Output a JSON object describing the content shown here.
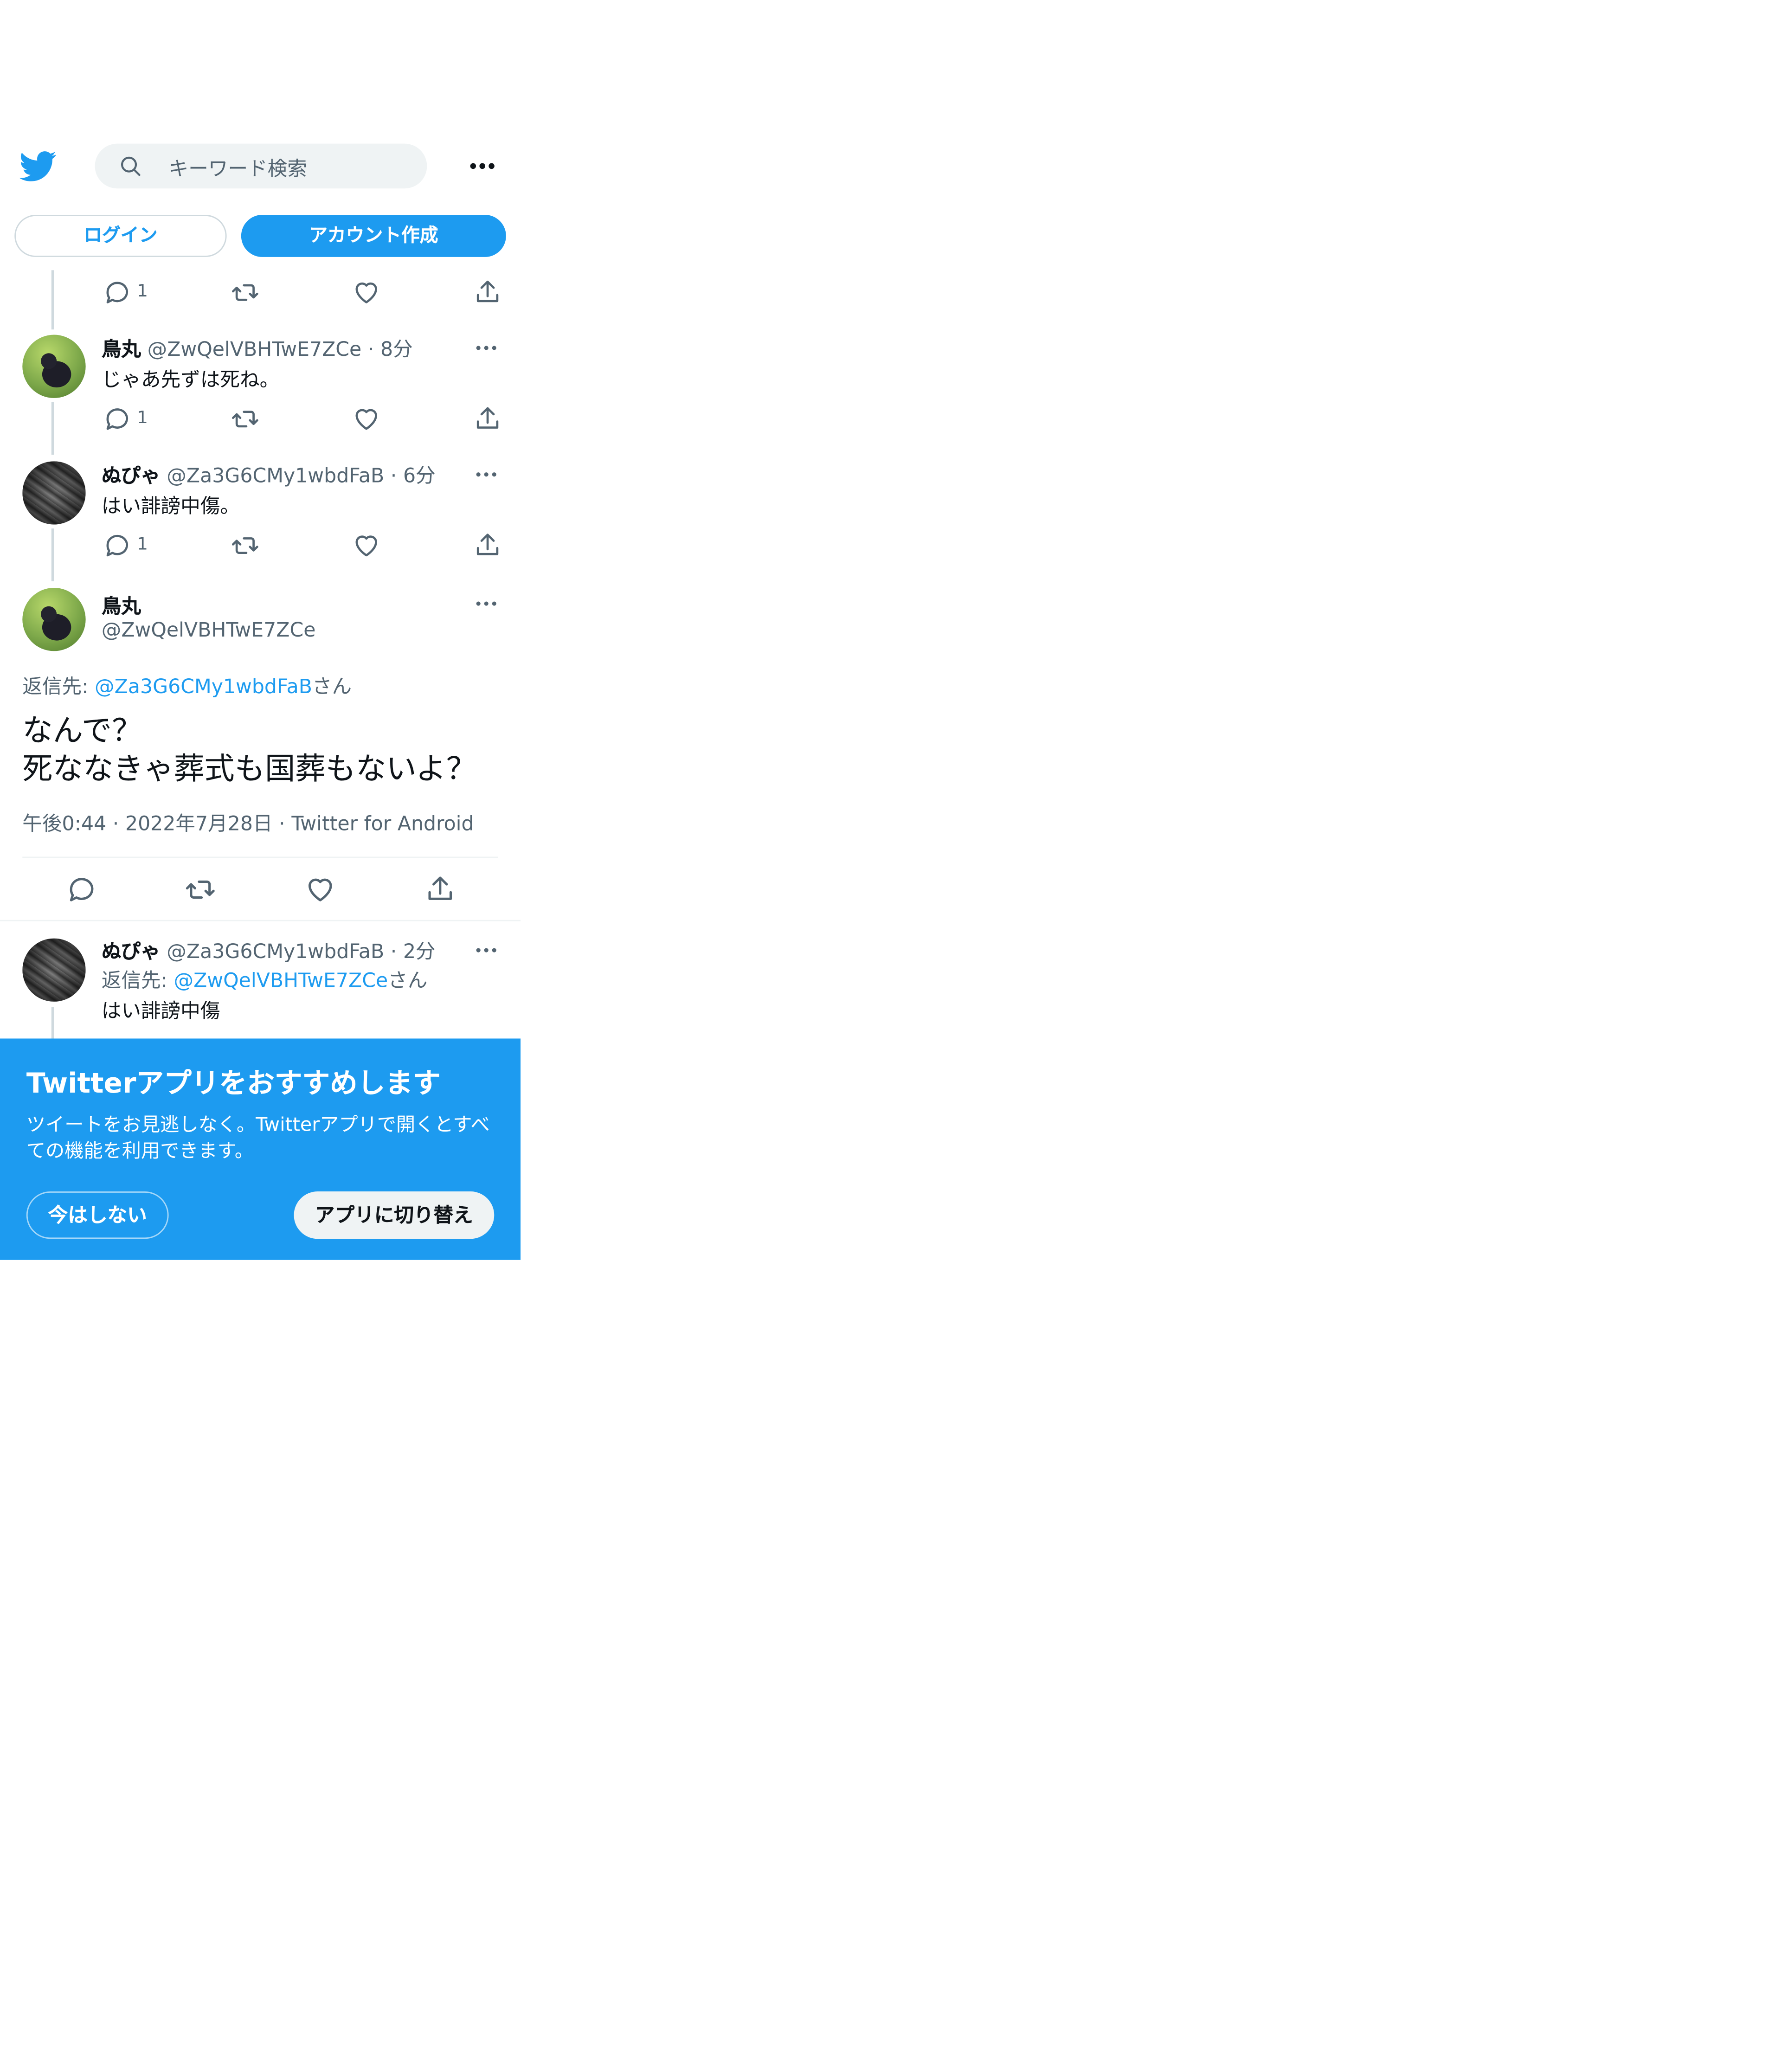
{
  "header": {
    "search_placeholder": "キーワード検索",
    "login_label": "ログイン",
    "signup_label": "アカウント作成"
  },
  "top_actions": {
    "reply_count": "1"
  },
  "tweets": [
    {
      "display_name": "鳥丸",
      "handle": "@ZwQelVBHTwE7ZCe",
      "time": "8分",
      "text": "じゃあ先ずは死ね。",
      "reply_count": "1"
    },
    {
      "display_name": "ぬぴゃ",
      "handle": "@Za3G6CMy1wbdFaB",
      "time": "6分",
      "text": "はい誹謗中傷。",
      "reply_count": "1"
    }
  ],
  "main_tweet": {
    "display_name": "鳥丸",
    "handle": "@ZwQelVBHTwE7ZCe",
    "reply_to_prefix": "返信先: ",
    "reply_to_handle": "@Za3G6CMy1wbdFaB",
    "reply_to_suffix": "さん",
    "text_line1": "なんで？",
    "text_line2": "死ななきゃ葬式も国葬もないよ？",
    "time": "午後0:44",
    "date": "2022年7月28日",
    "source": "Twitter for Android"
  },
  "reply_tweet": {
    "display_name": "ぬぴゃ",
    "handle": "@Za3G6CMy1wbdFaB",
    "time": "2分",
    "reply_to_prefix": "返信先: ",
    "reply_to_handle": "@ZwQelVBHTwE7ZCe",
    "reply_to_suffix": "さん",
    "text": "はい誹謗中傷"
  },
  "promo": {
    "title": "Twitterアプリをおすすめします",
    "description": "ツイートをお見逃しなく。Twitterアプリで開くとすべての機能を利用できます。",
    "dismiss_label": "今はしない",
    "switch_label": "アプリに切り替え"
  },
  "colors": {
    "brand_blue": "#1d9bf0",
    "text": "#0f1419",
    "muted": "#536471"
  }
}
